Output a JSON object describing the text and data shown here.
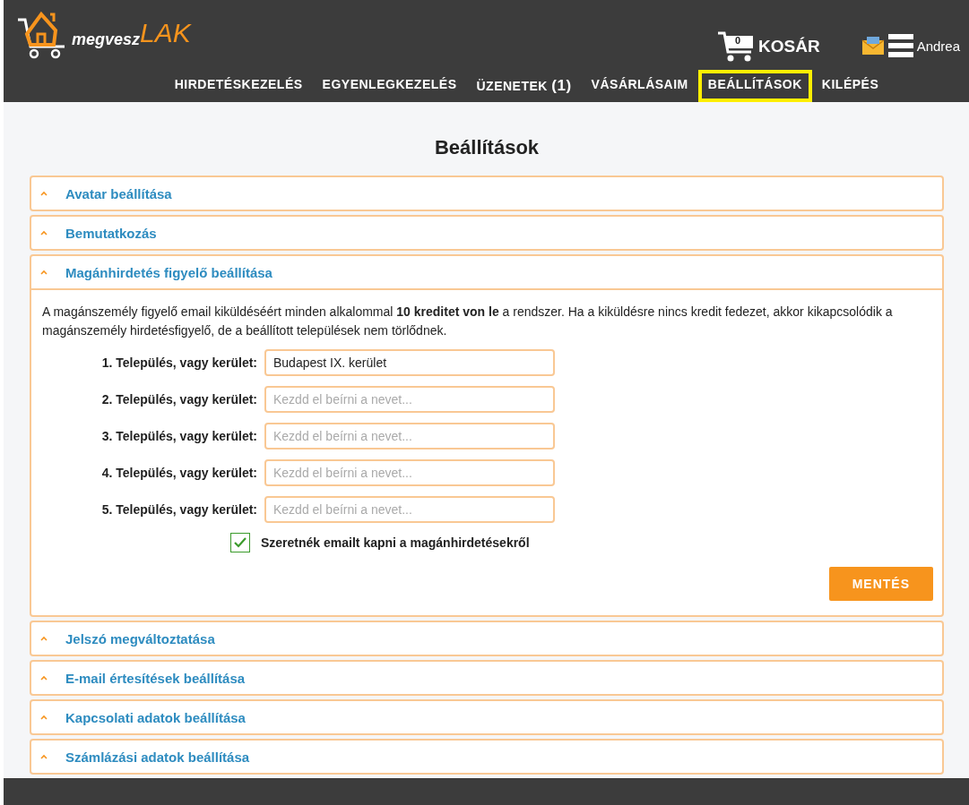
{
  "header": {
    "logo": {
      "part_1": "megvesz",
      "part_2": "LAK"
    },
    "cart": {
      "count": "0",
      "label": "KOSÁR"
    },
    "user": "Andrea",
    "nav": [
      {
        "label": "HIRDETÉSKEZELÉS",
        "selected": false
      },
      {
        "label": "EGYENLEGKEZELÉS",
        "selected": false
      },
      {
        "label": "ÜZENETEK **(1)**",
        "selected": false
      },
      {
        "label": "VÁSÁRLÁSAIM",
        "selected": false
      },
      {
        "label": "BEÁLLÍTÁSOK",
        "selected": true
      },
      {
        "label": "KILÉPÉS",
        "selected": false
      }
    ]
  },
  "page_title": "Beállítások",
  "sections": [
    {
      "title": "Avatar beállítása",
      "expanded": false
    },
    {
      "title": "Bemutatkozás",
      "expanded": false
    },
    {
      "title": "Magánhirdetés figyelő beállítása",
      "expanded": true
    },
    {
      "title": "Jelszó megváltoztatása",
      "expanded": false
    },
    {
      "title": "E-mail értesítések beállítása",
      "expanded": false
    },
    {
      "title": "Kapcsolati adatok beállítása",
      "expanded": false
    },
    {
      "title": "Számlázási adatok beállítása",
      "expanded": false
    }
  ],
  "watcher": {
    "description": "A magánszemély figyelő email kiküldéséért minden alkalommal **10 kreditet von le** a rendszer. Ha a kiküldésre nincs kredit fedezet, akkor kikapcsolódik a magánszemély hirdetésfigyelő, de a beállított települések nem törlődnek.",
    "fields": [
      {
        "label": "1. Település, vagy kerület:",
        "value": "Budapest IX. kerület"
      },
      {
        "label": "2. Település, vagy kerület:",
        "placeholder": "Kezdd el beírni a nevet..."
      },
      {
        "label": "3. Település, vagy kerület:",
        "placeholder": "Kezdd el beírni a nevet..."
      },
      {
        "label": "4. Település, vagy kerület:",
        "placeholder": "Kezdd el beírni a nevet..."
      },
      {
        "label": "5. Település, vagy kerület:",
        "placeholder": "Kezdd el beírni a nevet..."
      }
    ],
    "checkbox": {
      "label": "Szeretnék emailt kapni a magánhirdetésekről",
      "checked": true
    },
    "save_button": "MENTÉS"
  }
}
